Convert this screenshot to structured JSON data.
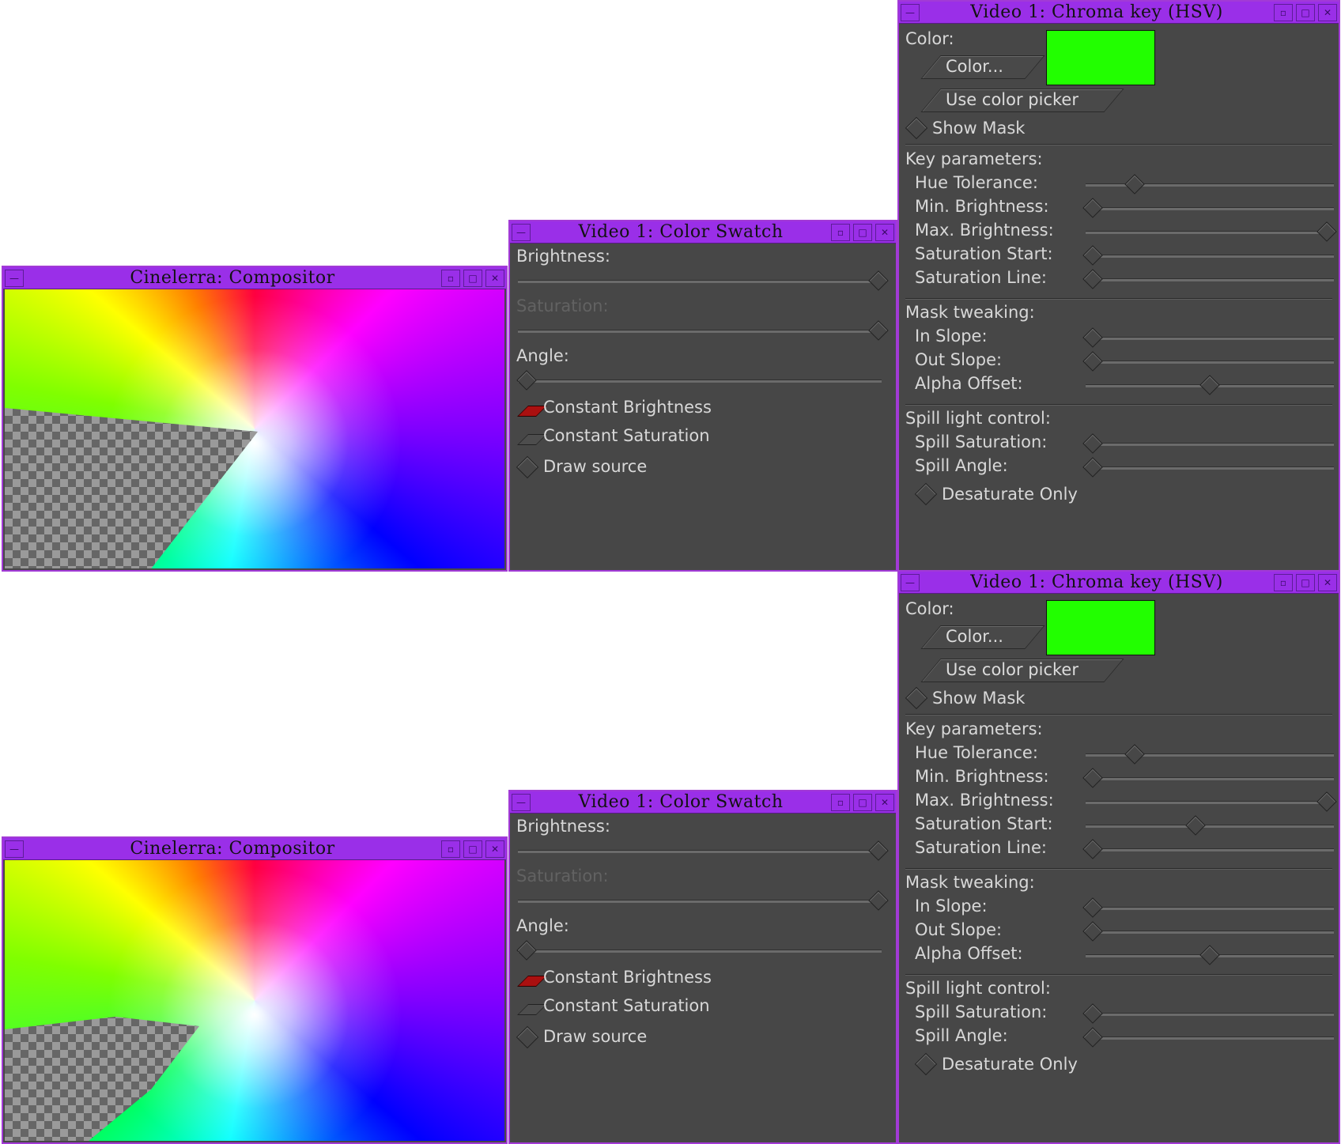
{
  "compositor": {
    "title": "Cinelerra: Compositor"
  },
  "swatch": {
    "title": "Video 1: Color Swatch",
    "brightness_label": "Brightness:",
    "saturation_label": "Saturation:",
    "angle_label": "Angle:",
    "brightness_value": 1.0,
    "saturation_value": 1.0,
    "angle_value": 0.0,
    "const_brightness_label": "Constant Brightness",
    "const_brightness_checked": true,
    "const_saturation_label": "Constant Saturation",
    "const_saturation_checked": false,
    "draw_source_label": "Draw source",
    "draw_source_checked": false
  },
  "chroma": {
    "title": "Video 1: Chroma key (HSV)",
    "color_label": "Color:",
    "color_button": "Color...",
    "color_value": "#22ff00",
    "picker_button": "Use color picker",
    "show_mask_label": "Show Mask",
    "key_params_label": "Key parameters:",
    "hue_tolerance_label": "Hue Tolerance:",
    "min_brightness_label": "Min. Brightness:",
    "max_brightness_label": "Max. Brightness:",
    "sat_start_label": "Saturation Start:",
    "sat_line_label": "Saturation Line:",
    "mask_tweak_label": "Mask tweaking:",
    "in_slope_label": "In Slope:",
    "out_slope_label": "Out Slope:",
    "alpha_offset_label": "Alpha Offset:",
    "spill_label": "Spill light control:",
    "spill_sat_label": "Spill Saturation:",
    "spill_angle_label": "Spill Angle:",
    "desaturate_label": "Desaturate Only"
  },
  "chroma_top_values": {
    "hue_tolerance": 0.18,
    "min_brightness": 0.0,
    "max_brightness": 1.0,
    "sat_start": 0.0,
    "sat_line": 0.0,
    "in_slope": 0.0,
    "out_slope": 0.0,
    "alpha_offset": 0.5,
    "spill_sat": 0.0,
    "spill_angle": 0.0
  },
  "chroma_bottom_values": {
    "hue_tolerance": 0.18,
    "min_brightness": 0.0,
    "max_brightness": 1.0,
    "sat_start": 0.44,
    "sat_line": 0.0,
    "in_slope": 0.0,
    "out_slope": 0.0,
    "alpha_offset": 0.5,
    "spill_sat": 0.0,
    "spill_angle": 0.0
  }
}
